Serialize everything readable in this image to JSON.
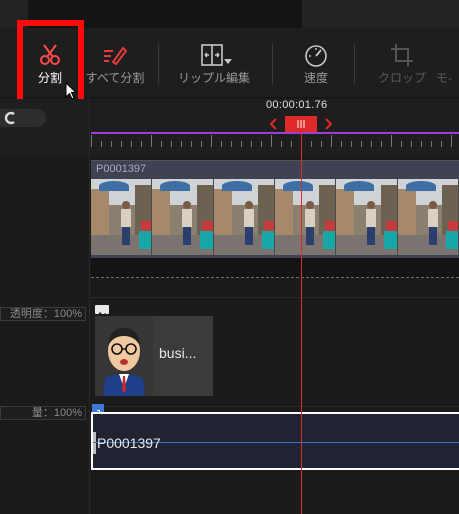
{
  "toolbar": {
    "split_label": "分割",
    "split_all_label": "すべて分割",
    "ripple_edit_label": "リップル編集",
    "speed_label": "速度",
    "crop_label": "クロップ",
    "mode_label": "モ-"
  },
  "timeline": {
    "timecode": "00:00:01.76"
  },
  "tracks": {
    "video": {
      "clip_name": "P0001397"
    },
    "image": {
      "header_label": "透明度：100%",
      "clip_title": "busi..."
    },
    "audio": {
      "header_label": "量：100%",
      "clip_name": "P0001397"
    }
  },
  "colors": {
    "accent_red": "#e02a2a",
    "highlight_red": "#ff0a0a",
    "ruler_purple": "#a23cd6",
    "audio_blue": "#3c79d8",
    "video_clip": "#3f4252"
  },
  "icons": {
    "split": "scissors-icon",
    "split_all": "pen-split-icon",
    "ripple": "ripple-edit-icon",
    "speed": "speedometer-icon",
    "crop": "crop-icon",
    "cursor": "mouse-cursor-icon"
  }
}
